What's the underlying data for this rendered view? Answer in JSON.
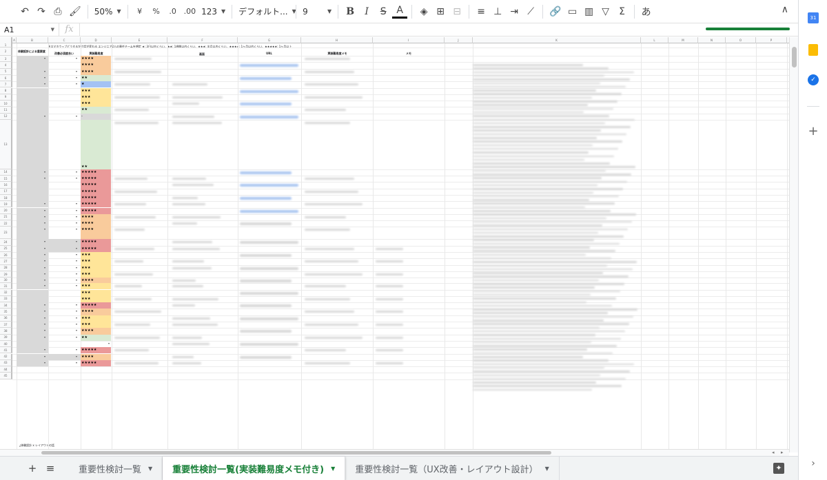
{
  "toolbar": {
    "undo_icon": "undo-icon",
    "zoom": "50%",
    "currency": "¥",
    "percent": "%",
    "dec_decrease": ".0",
    "dec_increase": ".00",
    "number_format": "123",
    "font": "デフォルト...",
    "font_size": "9",
    "input_tool": "あ"
  },
  "formula_bar": {
    "cell_ref": "A1",
    "fx": "fx",
    "value": ""
  },
  "columns": [
    "A",
    "B",
    "C",
    "D",
    "E",
    "F",
    "G",
    "H",
    "I",
    "J",
    "K",
    "L",
    "M",
    "N",
    "O",
    "P"
  ],
  "header_row": {
    "note": "※スマホウェブどうするかで話が変わる エンジニア2人の専任チームを想定  ★: 3日以内くらい、★★: 1週間以内くらい、★★★: 半月以内くらい、★★★★: 1ヶ月以内くらい、★★★★★: 1ヶ月以上",
    "b": "体験設計による重要度",
    "c": "改善必須度合い",
    "d": "実装難易度",
    "f": "画面",
    "g": "URL",
    "h": "実装難易度メモ",
    "i": "メモ"
  },
  "rows": [
    {
      "n": "1",
      "stars": ""
    },
    {
      "n": "2",
      "stars": ""
    },
    {
      "n": "3",
      "stars": "★★★★"
    },
    {
      "n": "4",
      "stars": "★★★★"
    },
    {
      "n": "5",
      "stars": "★★★★"
    },
    {
      "n": "6",
      "stars": "★★"
    },
    {
      "n": "7",
      "stars": "★"
    },
    {
      "n": "8",
      "stars": "★★★"
    },
    {
      "n": "9",
      "stars": "★★★"
    },
    {
      "n": "10",
      "stars": "★★★"
    },
    {
      "n": "11",
      "stars": "★★"
    },
    {
      "n": "12",
      "stars": "-"
    },
    {
      "n": "13",
      "stars": "★★"
    },
    {
      "n": "14",
      "stars": "★★★★★"
    },
    {
      "n": "15",
      "stars": "★★★★★"
    },
    {
      "n": "16",
      "stars": "★★★★★"
    },
    {
      "n": "17",
      "stars": "★★★★★"
    },
    {
      "n": "18",
      "stars": "★★★★★"
    },
    {
      "n": "19",
      "stars": "★★★★★"
    },
    {
      "n": "20",
      "stars": "★★★★★"
    },
    {
      "n": "21",
      "stars": "★★★★"
    },
    {
      "n": "22",
      "stars": "★★★★"
    },
    {
      "n": "23",
      "stars": "★★★★"
    },
    {
      "n": "24",
      "stars": "★★★★★"
    },
    {
      "n": "25",
      "stars": "★★★★★"
    },
    {
      "n": "26",
      "stars": "★★★"
    },
    {
      "n": "27",
      "stars": "★★★"
    },
    {
      "n": "28",
      "stars": "★★★"
    },
    {
      "n": "29",
      "stars": "★★★"
    },
    {
      "n": "30",
      "stars": "★★★★"
    },
    {
      "n": "31",
      "stars": "★★★"
    },
    {
      "n": "32",
      "stars": "★★★"
    },
    {
      "n": "33",
      "stars": "★★★"
    },
    {
      "n": "34",
      "stars": "★★★★★"
    },
    {
      "n": "35",
      "stars": "★★★★"
    },
    {
      "n": "36",
      "stars": "★★★"
    },
    {
      "n": "37",
      "stars": "★★★"
    },
    {
      "n": "38",
      "stars": "★★★★"
    },
    {
      "n": "39",
      "stars": "★★"
    },
    {
      "n": "40",
      "stars": ""
    },
    {
      "n": "41",
      "stars": "★★★★★"
    },
    {
      "n": "42",
      "stars": "★★★★"
    },
    {
      "n": "43",
      "stars": "★★★★★"
    },
    {
      "n": "44",
      "stars": ""
    },
    {
      "n": "45",
      "stars": ""
    }
  ],
  "footer_note": "¿体験設計 x レイアウトの話",
  "tabs": [
    {
      "label": "重要性検討一覧"
    },
    {
      "label": "重要性検討一覧(実装難易度メモ付き)"
    },
    {
      "label": "重要性検討一覧（UX改善・レイアウト設計）"
    }
  ],
  "colors": {
    "accent": "#188038",
    "star1": "#a4c2f4",
    "star2": "#d9ead3",
    "star3": "#ffe599",
    "star4": "#f9cb9c",
    "star5": "#ea9999",
    "grey": "#d9d9d9"
  }
}
